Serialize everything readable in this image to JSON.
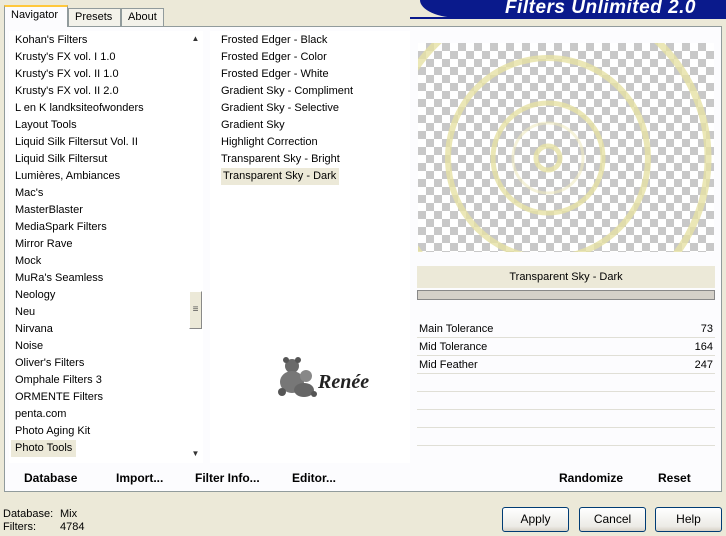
{
  "tabs": [
    {
      "label": "Navigator"
    },
    {
      "label": "Presets"
    },
    {
      "label": "About"
    }
  ],
  "banner": {
    "title": "Filters Unlimited 2.0"
  },
  "categories": [
    "Kohan's Filters",
    "Krusty's FX vol. I 1.0",
    "Krusty's FX vol. II 1.0",
    "Krusty's FX vol. II 2.0",
    "L en K landksiteofwonders",
    "Layout Tools",
    "Liquid Silk Filtersut Vol. II",
    "Liquid Silk Filtersut",
    "Lumières, Ambiances",
    "Mac's",
    "MasterBlaster",
    "MediaSpark Filters",
    "Mirror Rave",
    "Mock",
    "MuRa's Seamless",
    "Neology",
    "Neu",
    "Nirvana",
    "Noise",
    "Oliver's Filters",
    "Omphale Filters 3",
    "ORMENTE Filters",
    "penta.com",
    "Photo Aging Kit",
    "Photo Tools"
  ],
  "selected_category": "Photo Tools",
  "filters": [
    "Frosted Edger - Black",
    "Frosted Edger - Color",
    "Frosted Edger - White",
    "Gradient Sky - Compliment",
    "Gradient Sky - Selective",
    "Gradient Sky",
    "Highlight Correction",
    "Transparent Sky - Bright",
    "Transparent Sky - Dark"
  ],
  "selected_filter": "Transparent Sky - Dark",
  "current_filter_title": "Transparent Sky - Dark",
  "params": [
    {
      "label": "Main Tolerance",
      "value": "73",
      "level": 73
    },
    {
      "label": "Mid Tolerance",
      "value": "164",
      "level": 164
    },
    {
      "label": "Mid Feather",
      "value": "247",
      "level": 247
    }
  ],
  "buttons": {
    "database": "Database",
    "import": "Import...",
    "filter_info": "Filter Info...",
    "editor": "Editor...",
    "randomize": "Randomize",
    "reset": "Reset",
    "apply": "Apply",
    "cancel": "Cancel",
    "help": "Help"
  },
  "status": {
    "database_label": "Database:",
    "database_value": "Mix",
    "filters_label": "Filters:",
    "filters_value": "4784"
  },
  "logo_text": "Renée",
  "colors": {
    "banner": "#0a1a8c",
    "preview_ring": "#e8e3a8"
  }
}
